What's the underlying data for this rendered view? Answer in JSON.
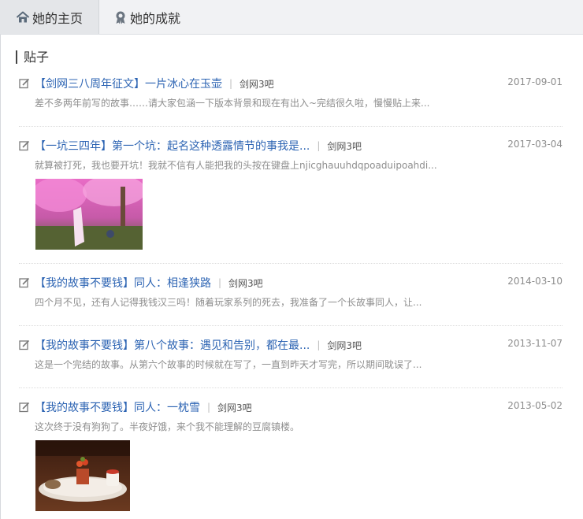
{
  "tabs": [
    {
      "label": "她的主页",
      "icon": "home-icon"
    },
    {
      "label": "她的成就",
      "icon": "medal-icon"
    }
  ],
  "section": {
    "title": "贴子"
  },
  "posts": [
    {
      "title": "【剑网三八周年征文】一片冰心在玉壶",
      "forum": "剑网3吧",
      "date": "2017-09-01",
      "excerpt": "差不多两年前写的故事……请大家包涵一下版本背景和现在有出入~完结很久啦，慢慢贴上来..."
    },
    {
      "title": "【一坑三四年】第一个坑：起名这种透露情节的事我是...",
      "forum": "剑网3吧",
      "date": "2017-03-04",
      "excerpt": "就算被打死，我也要开坑！我就不信有人能把我的头按在键盘上njicghauuhdqpoaduipoahdi..."
    },
    {
      "title": "【我的故事不要钱】同人：相逢狭路",
      "forum": "剑网3吧",
      "date": "2014-03-10",
      "excerpt": "四个月不见，还有人记得我钱汉三吗！随着玩家系列的死去，我准备了一个长故事同人，让..."
    },
    {
      "title": "【我的故事不要钱】第八个故事：遇见和告别，都在最...",
      "forum": "剑网3吧",
      "date": "2013-11-07",
      "excerpt": "这是一个完结的故事。从第六个故事的时候就在写了，一直到昨天才写完，所以期间耽误了..."
    },
    {
      "title": "【我的故事不要钱】同人：一枕雪",
      "forum": "剑网3吧",
      "date": "2013-05-02",
      "excerpt": "这次终于没有狗狗了。半夜好饿，来个我不能理解的豆腐镇楼。"
    }
  ],
  "colors": {
    "link": "#2d64b3",
    "muted": "#8e8e8e",
    "tab_bg": "#f1f2f4"
  }
}
